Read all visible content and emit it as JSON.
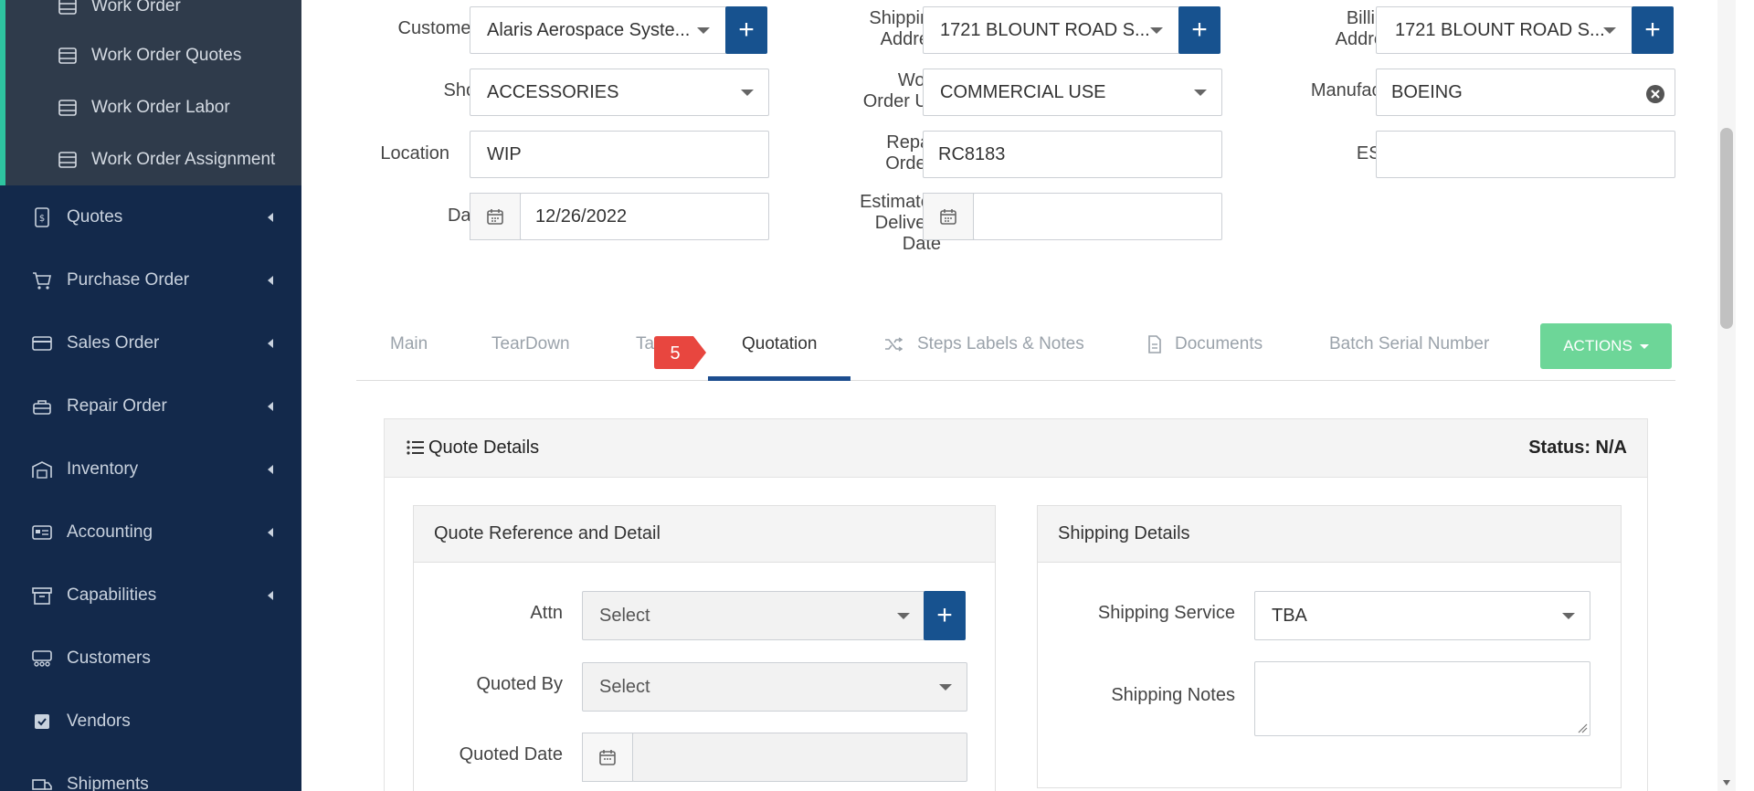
{
  "sidebar": {
    "sub_items": [
      {
        "label": "Work Order"
      },
      {
        "label": "Work Order Quotes"
      },
      {
        "label": "Work Order Labor"
      },
      {
        "label": "Work Order Assignment"
      }
    ],
    "items": [
      {
        "label": "Quotes",
        "icon": "quote-doc-icon"
      },
      {
        "label": "Purchase Order",
        "icon": "cart-icon"
      },
      {
        "label": "Sales Order",
        "icon": "credit-card-icon"
      },
      {
        "label": "Repair Order",
        "icon": "repair-icon"
      },
      {
        "label": "Inventory",
        "icon": "warehouse-icon"
      },
      {
        "label": "Accounting",
        "icon": "accounting-card-icon"
      },
      {
        "label": "Capabilities",
        "icon": "archive-icon"
      },
      {
        "label": "Customers",
        "icon": "users-icon"
      },
      {
        "label": "Vendors",
        "icon": "vendor-icon"
      },
      {
        "label": "Shipments",
        "icon": "truck-icon"
      }
    ]
  },
  "header_form": {
    "customers": {
      "label": "Customers",
      "value": "Alaris Aerospace Syste..."
    },
    "shipping_address": {
      "label_line1": "Shipping",
      "label_line2": "Address",
      "value": "1721 BLOUNT ROAD S..."
    },
    "billing_address": {
      "label_line1": "Billing",
      "label_line2": "Address",
      "value": "1721 BLOUNT ROAD S..."
    },
    "shop": {
      "label": "Shop",
      "value": "ACCESSORIES"
    },
    "work_order_use": {
      "label_line1": "Work",
      "label_line2": "Order Use",
      "value": "COMMERCIAL USE"
    },
    "manufacture": {
      "label": "Manufacture",
      "value": "BOEING"
    },
    "location": {
      "label": "Location",
      "value": "WIP"
    },
    "repair_order": {
      "label_line1": "Repair",
      "label_line2": "Order #",
      "value": "RC8183"
    },
    "esn": {
      "label": "ESN",
      "value": ""
    },
    "date": {
      "label": "Date",
      "value": "12/26/2022"
    },
    "estimated_delivery": {
      "label_line1": "Estimated",
      "label_line2": "Delivery",
      "label_line3": "Date",
      "value": ""
    }
  },
  "tabs": [
    {
      "label": "Main"
    },
    {
      "label": "TearDown"
    },
    {
      "label": "Ta"
    },
    {
      "label": "Quotation"
    },
    {
      "label": "Steps Labels & Notes"
    },
    {
      "label": "Documents"
    },
    {
      "label": "Batch Serial Number"
    }
  ],
  "step_badge": "5",
  "actions_label": "ACTIONS",
  "quote_panel": {
    "title": "Quote Details",
    "status": "Status: N/A",
    "reference_card": {
      "title": "Quote Reference and Detail",
      "attn_label": "Attn",
      "attn_value": "Select",
      "quoted_by_label": "Quoted By",
      "quoted_by_value": "Select",
      "quoted_date_label": "Quoted Date",
      "quoted_date_value": ""
    },
    "shipping_card": {
      "title": "Shipping Details",
      "service_label": "Shipping Service",
      "service_value": "TBA",
      "notes_label": "Shipping Notes",
      "notes_value": ""
    }
  },
  "colors": {
    "sidebar_bg": "#13294b",
    "submenu_bg": "#2f3b4b",
    "accent": "#2ec4a0",
    "primary_button": "#17528f",
    "actions_button": "#6dd698",
    "required": "#d9232d",
    "badge": "#e8463f"
  }
}
